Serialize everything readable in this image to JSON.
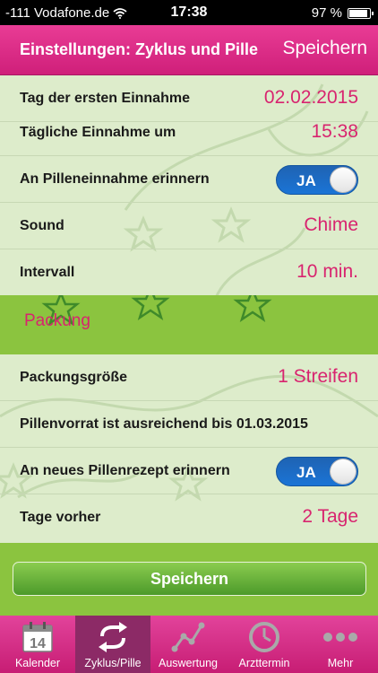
{
  "status_bar": {
    "carrier": "-111 Vodafone.de",
    "time": "17:38",
    "battery": "97 %",
    "battery_level": 0.97
  },
  "navbar": {
    "title": "Einstellungen: Zyklus und Pille",
    "save_label": "Speichern"
  },
  "settings": {
    "first_intake_label": "Tag der ersten Einnahme",
    "first_intake_value": "02.02.2015",
    "daily_time_label": "Tägliche Einnahme um",
    "daily_time_value": "15:38",
    "remind_pill_label": "An Pilleneinnahme erinnern",
    "remind_pill_toggle": "JA",
    "sound_label": "Sound",
    "sound_value": "Chime",
    "interval_label": "Intervall",
    "interval_value": "10 min."
  },
  "packaging": {
    "section_title": "Packung",
    "size_label": "Packungsgröße",
    "size_value": "1 Streifen",
    "supply_text": "Pillenvorrat ist ausreichend bis 01.03.2015",
    "remind_rx_label": "An neues Pillenrezept erinnern",
    "remind_rx_toggle": "JA",
    "days_before_label": "Tage vorher",
    "days_before_value": "2 Tage"
  },
  "save_button": "Speichern",
  "tabbar": {
    "items": [
      {
        "label": "Kalender",
        "icon": "calendar-icon",
        "icon_text": "14"
      },
      {
        "label": "Zyklus/Pille",
        "icon": "cycle-arrows-icon"
      },
      {
        "label": "Auswertung",
        "icon": "chart-line-icon"
      },
      {
        "label": "Arzttermin",
        "icon": "clock-icon"
      },
      {
        "label": "Mehr",
        "icon": "more-dots-icon"
      }
    ],
    "active_index": 1
  },
  "colors": {
    "brand_pink": "#d8246f",
    "nav_pink": "#e93c95",
    "green": "#8bc43f",
    "background": "#ddeccb",
    "toggle_blue": "#1a6fd0"
  }
}
